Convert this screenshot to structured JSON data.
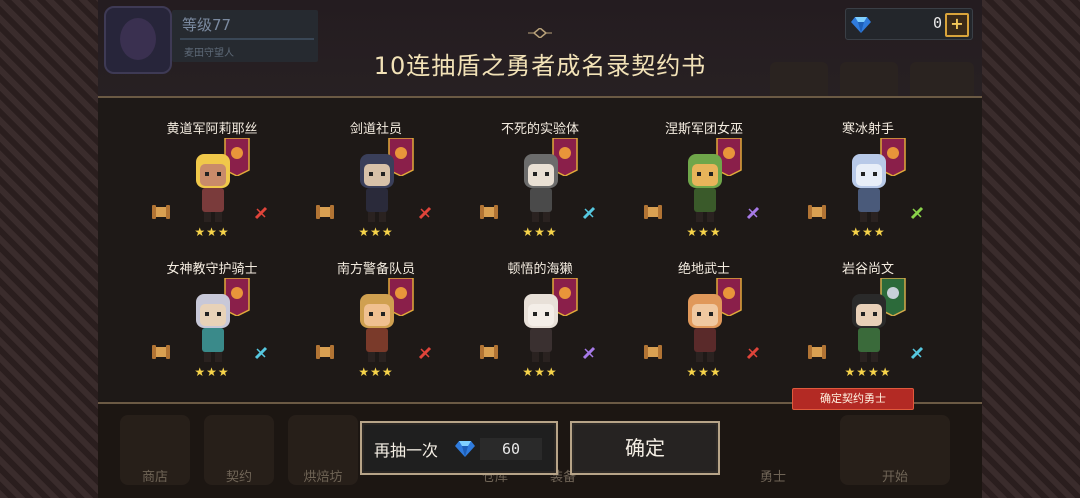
{
  "profile": {
    "level": "等级77",
    "subtitle": "麦田守望人"
  },
  "currency": {
    "gems": "0"
  },
  "title": "10连抽盾之勇者成名录契约书",
  "heroes": [
    {
      "name": "黄道军阿莉耶丝",
      "stars": "★★★",
      "class_icon": "sword-icon",
      "class_color": "#e0443a"
    },
    {
      "name": "剑道社员",
      "stars": "★★★",
      "class_icon": "sword-icon",
      "class_color": "#e0443a"
    },
    {
      "name": "不死的实验体",
      "stars": "★★★",
      "class_icon": "hammer-icon",
      "class_color": "#56c8e0"
    },
    {
      "name": "涅斯军团女巫",
      "stars": "★★★",
      "class_icon": "staff-icon",
      "class_color": "#a77ae8"
    },
    {
      "name": "寒冰射手",
      "stars": "★★★",
      "class_icon": "bow-icon",
      "class_color": "#8ad34a"
    },
    {
      "name": "女神教守护骑士",
      "stars": "★★★",
      "class_icon": "hammer-icon",
      "class_color": "#56c8e0"
    },
    {
      "name": "南方警备队员",
      "stars": "★★★",
      "class_icon": "sword-icon",
      "class_color": "#e0443a"
    },
    {
      "name": "顿悟的海獭",
      "stars": "★★★",
      "class_icon": "staff-icon",
      "class_color": "#a77ae8"
    },
    {
      "name": "绝地武士",
      "stars": "★★★",
      "class_icon": "sword-icon",
      "class_color": "#e0443a"
    },
    {
      "name": "岩谷尚文",
      "stars": "★★★★",
      "class_icon": "hammer-icon",
      "class_color": "#56c8e0"
    }
  ],
  "badge": "确定契约勇士",
  "buttons": {
    "redraw_label": "再抽一次",
    "redraw_cost": "60",
    "confirm_label": "确定"
  },
  "background_nav": [
    "商店",
    "契约",
    "烘焙坊",
    "仓库",
    "装备",
    "勇士",
    "开始"
  ]
}
